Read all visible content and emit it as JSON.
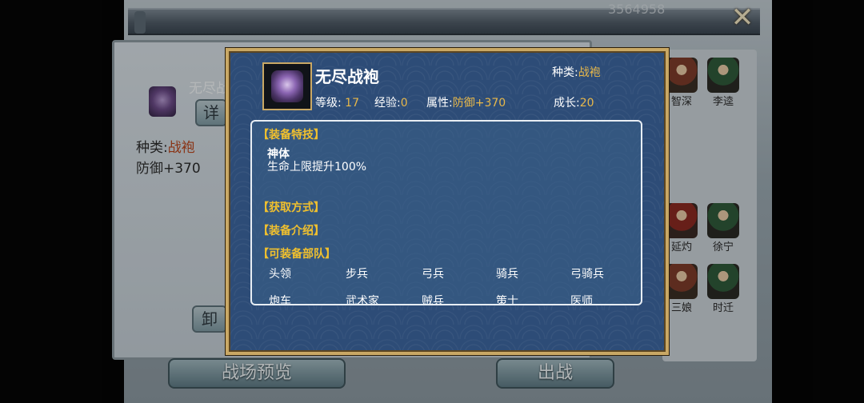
{
  "background": {
    "id_text": "3564958",
    "close_glyph": "✕",
    "left_panel": {
      "item_name": "无尽战",
      "detail_button": "详",
      "type_label": "种类:",
      "type_value": "战袍",
      "defense": "防御+370",
      "unequip_button": "卸"
    },
    "heroes": [
      {
        "name": "智深"
      },
      {
        "name": "李逵"
      },
      {
        "name": "延灼"
      },
      {
        "name": "徐宁"
      },
      {
        "name": "三娘"
      },
      {
        "name": "时迁"
      }
    ],
    "buttons": {
      "preview": "战场预览",
      "battle": "出战"
    }
  },
  "dialog": {
    "item": {
      "name": "无尽战袍",
      "type_label": "种类:",
      "type_value": "战袍",
      "level_label": "等级:",
      "level_value": "17",
      "exp_label": "经验:",
      "exp_value": "0",
      "attr_label": "属性:",
      "attr_value": "防御+370",
      "growth_label": "成长:",
      "growth_value": "20"
    },
    "sections": {
      "skill_title": "【装备特技】",
      "skill_name": "神体",
      "skill_desc": "生命上限提升100%",
      "source_title": "【获取方式】",
      "intro_title": "【装备介绍】",
      "troops_title": "【可装备部队】"
    },
    "troops_row1": [
      "头领",
      "步兵",
      "弓兵",
      "骑兵",
      "弓骑兵"
    ],
    "troops_row2": [
      "炮车",
      "武术家",
      "贼兵",
      "策士",
      "医师"
    ]
  },
  "colors": {
    "dialog_bg": "#2d4c77",
    "gold_border": "#c9a865",
    "value_gold": "#e8b84a",
    "section_yellow": "#f0c02e"
  }
}
